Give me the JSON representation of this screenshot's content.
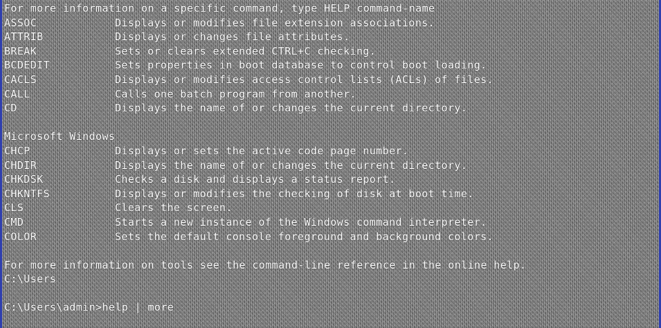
{
  "terminal": {
    "lines": [
      {
        "kind": "full",
        "text": "For more information on a specific command, type HELP command-name"
      },
      {
        "kind": "entry",
        "cmd": "ASSOC",
        "desc": "Displays or modifies file extension associations."
      },
      {
        "kind": "entry",
        "cmd": "ATTRIB",
        "desc": "Displays or changes file attributes."
      },
      {
        "kind": "entry",
        "cmd": "BREAK",
        "desc": "Sets or clears extended CTRL+C checking."
      },
      {
        "kind": "entry",
        "cmd": "BCDEDIT",
        "desc": "Sets properties in boot database to control boot loading."
      },
      {
        "kind": "entry",
        "cmd": "CACLS",
        "desc": "Displays or modifies access control lists (ACLs) of files."
      },
      {
        "kind": "entry",
        "cmd": "CALL",
        "desc": "Calls one batch program from another."
      },
      {
        "kind": "entry",
        "cmd": "CD",
        "desc": "Displays the name of or changes the current directory."
      },
      {
        "kind": "blank"
      },
      {
        "kind": "full",
        "text": "Microsoft Windows"
      },
      {
        "kind": "entry",
        "cmd": "CHCP",
        "desc": "Displays or sets the active code page number."
      },
      {
        "kind": "entry",
        "cmd": "CHDIR",
        "desc": "Displays the name of or changes the current directory."
      },
      {
        "kind": "entry",
        "cmd": "CHKDSK",
        "desc": "Checks a disk and displays a status report."
      },
      {
        "kind": "entry",
        "cmd": "CHKNTFS",
        "desc": "Displays or modifies the checking of disk at boot time."
      },
      {
        "kind": "entry",
        "cmd": "CLS",
        "desc": "Clears the screen."
      },
      {
        "kind": "entry",
        "cmd": "CMD",
        "desc": "Starts a new instance of the Windows command interpreter."
      },
      {
        "kind": "entry",
        "cmd": "COLOR",
        "desc": "Sets the default console foreground and background colors."
      },
      {
        "kind": "blank"
      },
      {
        "kind": "full",
        "text": "For more information on tools see the command-line reference in the online help."
      },
      {
        "kind": "full",
        "text": "C:\\Users"
      },
      {
        "kind": "blank"
      },
      {
        "kind": "full",
        "text": "C:\\Users\\admin>help | more"
      },
      {
        "kind": "blank"
      }
    ]
  },
  "colors": {
    "background": "#909090",
    "text": "#ffffff",
    "edge": "#2f3fae"
  }
}
